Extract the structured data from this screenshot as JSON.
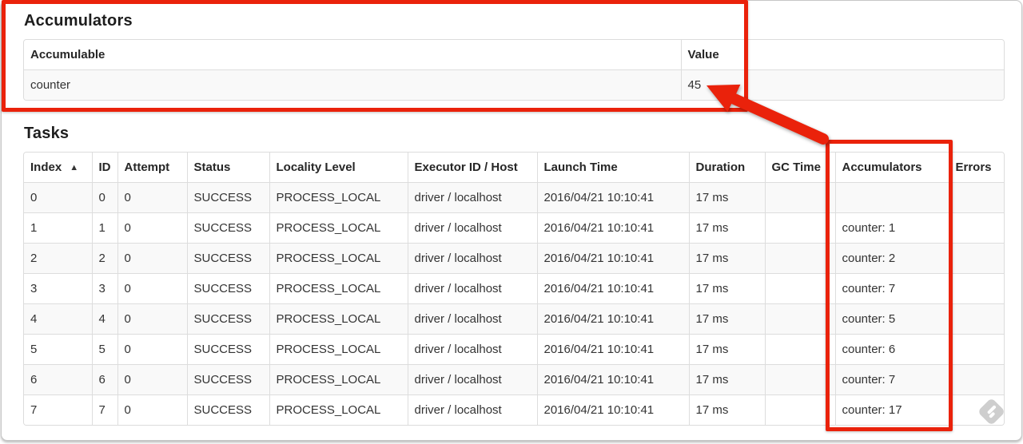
{
  "accumulators": {
    "title": "Accumulators",
    "table": {
      "headers": [
        "Accumulable",
        "Value"
      ],
      "row": {
        "accumulable": "counter",
        "value": "45"
      }
    }
  },
  "tasks": {
    "title": "Tasks",
    "table": {
      "headers": {
        "index": "Index",
        "sort": "▲",
        "id": "ID",
        "attempt": "Attempt",
        "status": "Status",
        "locality": "Locality Level",
        "executor": "Executor ID / Host",
        "launch": "Launch Time",
        "duration": "Duration",
        "gc": "GC Time",
        "accumulators": "Accumulators",
        "errors": "Errors"
      },
      "rows": [
        {
          "index": "0",
          "id": "0",
          "attempt": "0",
          "status": "SUCCESS",
          "locality": "PROCESS_LOCAL",
          "executor": "driver / localhost",
          "launch": "2016/04/21 10:10:41",
          "duration": "17 ms",
          "gc": "",
          "accumulators": "",
          "errors": ""
        },
        {
          "index": "1",
          "id": "1",
          "attempt": "0",
          "status": "SUCCESS",
          "locality": "PROCESS_LOCAL",
          "executor": "driver / localhost",
          "launch": "2016/04/21 10:10:41",
          "duration": "17 ms",
          "gc": "",
          "accumulators": "counter: 1",
          "errors": ""
        },
        {
          "index": "2",
          "id": "2",
          "attempt": "0",
          "status": "SUCCESS",
          "locality": "PROCESS_LOCAL",
          "executor": "driver / localhost",
          "launch": "2016/04/21 10:10:41",
          "duration": "17 ms",
          "gc": "",
          "accumulators": "counter: 2",
          "errors": ""
        },
        {
          "index": "3",
          "id": "3",
          "attempt": "0",
          "status": "SUCCESS",
          "locality": "PROCESS_LOCAL",
          "executor": "driver / localhost",
          "launch": "2016/04/21 10:10:41",
          "duration": "17 ms",
          "gc": "",
          "accumulators": "counter: 7",
          "errors": ""
        },
        {
          "index": "4",
          "id": "4",
          "attempt": "0",
          "status": "SUCCESS",
          "locality": "PROCESS_LOCAL",
          "executor": "driver / localhost",
          "launch": "2016/04/21 10:10:41",
          "duration": "17 ms",
          "gc": "",
          "accumulators": "counter: 5",
          "errors": ""
        },
        {
          "index": "5",
          "id": "5",
          "attempt": "0",
          "status": "SUCCESS",
          "locality": "PROCESS_LOCAL",
          "executor": "driver / localhost",
          "launch": "2016/04/21 10:10:41",
          "duration": "17 ms",
          "gc": "",
          "accumulators": "counter: 6",
          "errors": ""
        },
        {
          "index": "6",
          "id": "6",
          "attempt": "0",
          "status": "SUCCESS",
          "locality": "PROCESS_LOCAL",
          "executor": "driver / localhost",
          "launch": "2016/04/21 10:10:41",
          "duration": "17 ms",
          "gc": "",
          "accumulators": "counter: 7",
          "errors": ""
        },
        {
          "index": "7",
          "id": "7",
          "attempt": "0",
          "status": "SUCCESS",
          "locality": "PROCESS_LOCAL",
          "executor": "driver / localhost",
          "launch": "2016/04/21 10:10:41",
          "duration": "17 ms",
          "gc": "",
          "accumulators": "counter: 17",
          "errors": ""
        }
      ]
    }
  },
  "annotations": {
    "highlight_color": "#ea220b"
  },
  "watermark": {
    "icon": "diamond-logo-icon"
  }
}
